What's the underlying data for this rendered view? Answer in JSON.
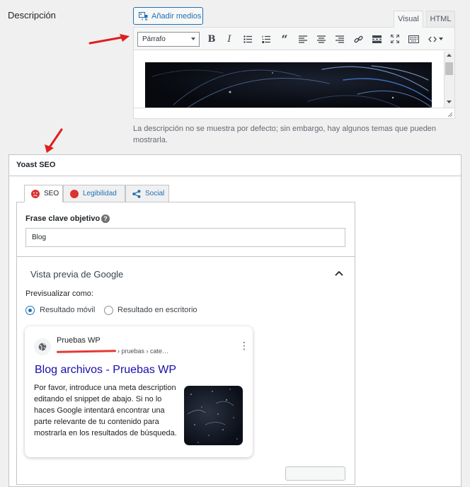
{
  "description": {
    "label": "Descripción",
    "add_media_label": "Añadir medios",
    "tabs": {
      "visual": "Visual",
      "html": "HTML"
    },
    "format_select_value": "Párrafo",
    "toolbar_icons": [
      "bold-icon",
      "italic-icon",
      "bullet-list-icon",
      "numbered-list-icon",
      "blockquote-icon",
      "align-left-icon",
      "align-center-icon",
      "align-right-icon",
      "link-icon",
      "read-more-icon",
      "fullscreen-icon",
      "toolbar-toggle-icon",
      "code-icon"
    ],
    "help_text": "La descripción no se muestra por defecto; sin embargo, hay algunos temas que pueden mostrarla."
  },
  "yoast": {
    "title": "Yoast SEO",
    "tabs": [
      {
        "label": "SEO",
        "status": "bad"
      },
      {
        "label": "Legibilidad",
        "status": "bad"
      },
      {
        "label": "Social"
      }
    ],
    "keyphrase": {
      "label": "Frase clave objetivo",
      "help": "?",
      "value": "Blog"
    },
    "google_preview": {
      "title": "Vista previa de Google",
      "preview_as": "Previsualizar como:",
      "options": [
        "Resultado móvil",
        "Resultado en escritorio"
      ],
      "selected": "Resultado móvil",
      "serp": {
        "site_name": "Pruebas WP",
        "breadcrumb": "› pruebas › cate…",
        "title": "Blog archivos - Pruebas WP",
        "snippet": "Por favor, introduce una meta description editando el snippet de abajo. Si no lo haces Google intentará encontrar una parte relevante de tu contenido para mostrarla en los resultados de búsqueda."
      }
    }
  },
  "colors": {
    "accent": "#2271b1",
    "bad": "#dc3232",
    "serp_title": "#1a0dab",
    "annotation": "#e01e1e"
  }
}
